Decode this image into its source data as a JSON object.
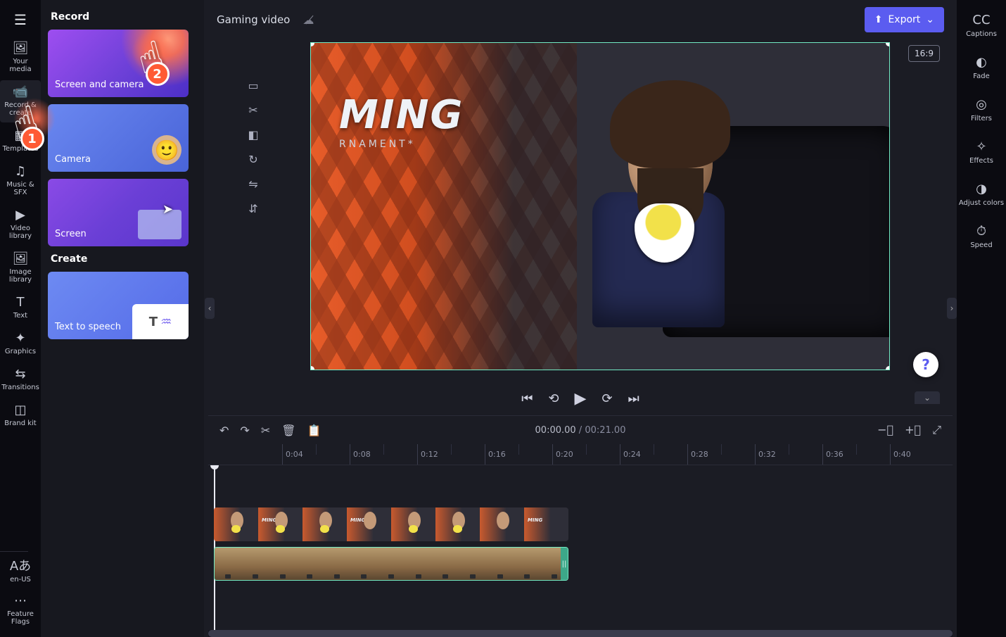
{
  "project": {
    "name": "Gaming video"
  },
  "export": {
    "label": "Export"
  },
  "aspect": {
    "label": "16:9"
  },
  "leftRail": {
    "items": [
      {
        "label": "Your media",
        "glyph": "🖼"
      },
      {
        "label": "Record & create",
        "glyph": "📹"
      },
      {
        "label": "Templates",
        "glyph": "▦"
      },
      {
        "label": "Music & SFX",
        "glyph": "♫"
      },
      {
        "label": "Video library",
        "glyph": "▶"
      },
      {
        "label": "Image library",
        "glyph": "🖼"
      },
      {
        "label": "Text",
        "glyph": "T"
      },
      {
        "label": "Graphics",
        "glyph": "✦"
      },
      {
        "label": "Transitions",
        "glyph": "⇆"
      },
      {
        "label": "Brand kit",
        "glyph": "◫"
      }
    ],
    "bottom": [
      {
        "label": "en-US",
        "glyph": "Aあ"
      },
      {
        "label": "Feature Flags",
        "glyph": "⋯"
      }
    ]
  },
  "panel": {
    "sections": [
      {
        "title": "Record",
        "tiles": [
          {
            "label": "Screen and camera"
          },
          {
            "label": "Camera"
          },
          {
            "label": "Screen"
          }
        ]
      },
      {
        "title": "Create",
        "tiles": [
          {
            "label": "Text to speech"
          }
        ]
      }
    ]
  },
  "callouts": {
    "badge1": "1",
    "badge2": "2"
  },
  "canvasTools": [
    {
      "name": "freehand",
      "glyph": "▭"
    },
    {
      "name": "crop",
      "glyph": "✂"
    },
    {
      "name": "pip",
      "glyph": "◧"
    },
    {
      "name": "rotate",
      "glyph": "↻"
    },
    {
      "name": "flip-h",
      "glyph": "⇋"
    },
    {
      "name": "flip-v",
      "glyph": "⇵"
    }
  ],
  "preview": {
    "logo": "MING",
    "logo_sub": "RNAMENT*"
  },
  "playback": {
    "current": "00:00.00",
    "separator": " / ",
    "duration": "00:21.00"
  },
  "timelineToolbar": {
    "items": [
      "↶",
      "↷",
      "✂",
      "🗑",
      "📋"
    ]
  },
  "ruler": {
    "marks": [
      "0:04",
      "0:08",
      "0:12",
      "0:16",
      "0:20",
      "0:24",
      "0:28",
      "0:32",
      "0:36",
      "0:40"
    ]
  },
  "rightRail": {
    "items": [
      {
        "label": "Captions",
        "glyph": "CC"
      },
      {
        "label": "Fade",
        "glyph": "◐"
      },
      {
        "label": "Filters",
        "glyph": "◎"
      },
      {
        "label": "Effects",
        "glyph": "✧"
      },
      {
        "label": "Adjust colors",
        "glyph": "◑"
      },
      {
        "label": "Speed",
        "glyph": "⏱"
      }
    ]
  },
  "help": {
    "label": "?"
  },
  "thumbText": "MING"
}
